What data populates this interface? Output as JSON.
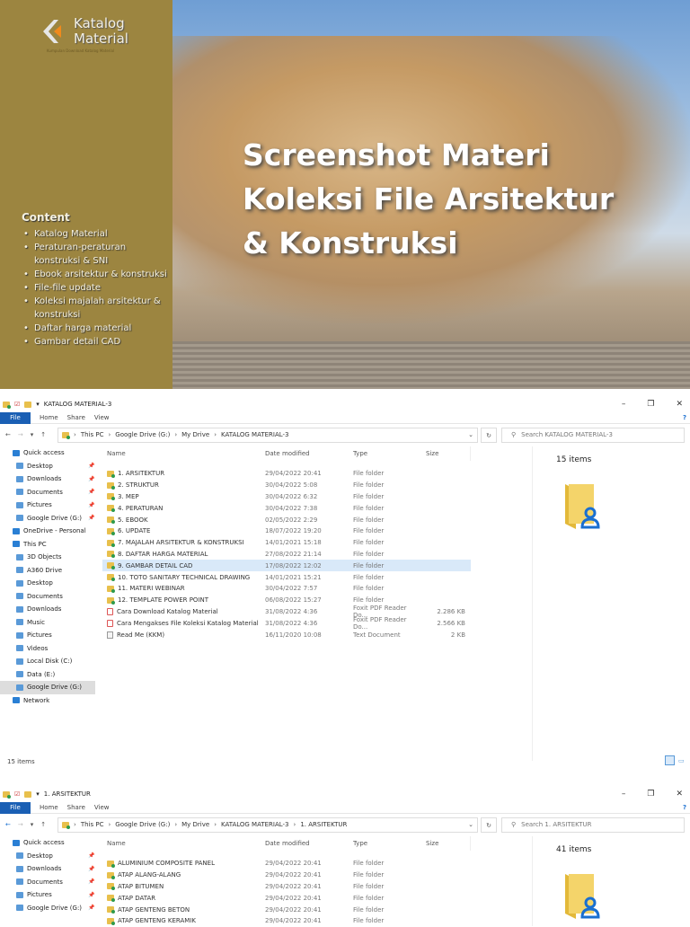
{
  "hero": {
    "logo_line1": "Katalog",
    "logo_line2": "Material",
    "logo_sub": "Kumpulan Download Katalog Material",
    "title_lines": [
      "Screenshot Materi",
      "Koleksi File Arsitektur",
      "& Konstruksi"
    ],
    "content_title": "Content",
    "content_items": [
      "Katalog Material",
      "Peraturan-peraturan konstruksi & SNI",
      "Ebook arsitektur & konstruksi",
      "File-file update",
      "Koleksi majalah arsitektur & konstruksi",
      "Daftar harga material",
      "Gambar detail CAD"
    ]
  },
  "win1": {
    "title": "KATALOG MATERIAL-3",
    "tabs": [
      "File",
      "Home",
      "Share",
      "View"
    ],
    "path": [
      "This PC",
      "Google Drive (G:)",
      "My Drive",
      "KATALOG MATERIAL-3"
    ],
    "search_placeholder": "Search KATALOG MATERIAL-3",
    "columns": [
      "Name",
      "Date modified",
      "Type",
      "Size"
    ],
    "nav": [
      {
        "label": "Quick access",
        "top": true
      },
      {
        "label": "Desktop",
        "pin": true
      },
      {
        "label": "Downloads",
        "pin": true
      },
      {
        "label": "Documents",
        "pin": true
      },
      {
        "label": "Pictures",
        "pin": true
      },
      {
        "label": "Google Drive (G:)",
        "pin": true
      },
      {
        "label": "OneDrive - Personal",
        "top": true
      },
      {
        "label": "This PC",
        "top": true
      },
      {
        "label": "3D Objects"
      },
      {
        "label": "A360 Drive"
      },
      {
        "label": "Desktop"
      },
      {
        "label": "Documents"
      },
      {
        "label": "Downloads"
      },
      {
        "label": "Music"
      },
      {
        "label": "Pictures"
      },
      {
        "label": "Videos"
      },
      {
        "label": "Local Disk (C:)"
      },
      {
        "label": "Data (E:)"
      },
      {
        "label": "Google Drive (G:)",
        "selected": true
      },
      {
        "label": "Network",
        "top": true
      }
    ],
    "files": [
      {
        "name": "1. ARSITEKTUR",
        "date": "29/04/2022 20:41",
        "type": "File folder",
        "size": "",
        "kind": "folder"
      },
      {
        "name": "2. STRUKTUR",
        "date": "30/04/2022 5:08",
        "type": "File folder",
        "size": "",
        "kind": "folder"
      },
      {
        "name": "3. MEP",
        "date": "30/04/2022 6:32",
        "type": "File folder",
        "size": "",
        "kind": "folder"
      },
      {
        "name": "4. PERATURAN",
        "date": "30/04/2022 7:38",
        "type": "File folder",
        "size": "",
        "kind": "folder"
      },
      {
        "name": "5. EBOOK",
        "date": "02/05/2022 2:29",
        "type": "File folder",
        "size": "",
        "kind": "folder"
      },
      {
        "name": "6. UPDATE",
        "date": "18/07/2022 19:20",
        "type": "File folder",
        "size": "",
        "kind": "folder"
      },
      {
        "name": "7. MAJALAH ARSITEKTUR & KONSTRUKSI",
        "date": "14/01/2021 15:18",
        "type": "File folder",
        "size": "",
        "kind": "folder"
      },
      {
        "name": "8. DAFTAR HARGA MATERIAL",
        "date": "27/08/2022 21:14",
        "type": "File folder",
        "size": "",
        "kind": "folder"
      },
      {
        "name": "9. GAMBAR DETAIL CAD",
        "date": "17/08/2022 12:02",
        "type": "File folder",
        "size": "",
        "kind": "folder",
        "selected": true
      },
      {
        "name": "10. TOTO SANITARY TECHNICAL DRAWING",
        "date": "14/01/2021 15:21",
        "type": "File folder",
        "size": "",
        "kind": "folder"
      },
      {
        "name": "11. MATERI WEBINAR",
        "date": "30/04/2022 7:57",
        "type": "File folder",
        "size": "",
        "kind": "folder"
      },
      {
        "name": "12. TEMPLATE POWER POINT",
        "date": "06/08/2022 15:27",
        "type": "File folder",
        "size": "",
        "kind": "folder"
      },
      {
        "name": "Cara Download Katalog Material",
        "date": "31/08/2022 4:36",
        "type": "Foxit PDF Reader Do...",
        "size": "2.286 KB",
        "kind": "pdf"
      },
      {
        "name": "Cara Mengakses File Koleksi Katalog Material",
        "date": "31/08/2022 4:36",
        "type": "Foxit PDF Reader Do...",
        "size": "2.566 KB",
        "kind": "pdf"
      },
      {
        "name": "Read Me (KKM)",
        "date": "16/11/2020 10:08",
        "type": "Text Document",
        "size": "2 KB",
        "kind": "txt"
      }
    ],
    "item_count": "15 items",
    "status": "15 items"
  },
  "win2": {
    "title": "1. ARSITEKTUR",
    "tabs": [
      "File",
      "Home",
      "Share",
      "View"
    ],
    "path": [
      "This PC",
      "Google Drive (G:)",
      "My Drive",
      "KATALOG MATERIAL-3",
      "1. ARSITEKTUR"
    ],
    "search_placeholder": "Search 1. ARSITEKTUR",
    "columns": [
      "Name",
      "Date modified",
      "Type",
      "Size"
    ],
    "nav": [
      {
        "label": "Quick access",
        "top": true
      },
      {
        "label": "Desktop",
        "pin": true
      },
      {
        "label": "Downloads",
        "pin": true
      },
      {
        "label": "Documents",
        "pin": true
      },
      {
        "label": "Pictures",
        "pin": true
      },
      {
        "label": "Google Drive (G:)",
        "pin": true
      }
    ],
    "files": [
      {
        "name": "ALUMINIUM COMPOSITE PANEL",
        "date": "29/04/2022 20:41",
        "type": "File folder",
        "size": "",
        "kind": "folder"
      },
      {
        "name": "ATAP ALANG-ALANG",
        "date": "29/04/2022 20:41",
        "type": "File folder",
        "size": "",
        "kind": "folder"
      },
      {
        "name": "ATAP BITUMEN",
        "date": "29/04/2022 20:41",
        "type": "File folder",
        "size": "",
        "kind": "folder"
      },
      {
        "name": "ATAP DATAR",
        "date": "29/04/2022 20:41",
        "type": "File folder",
        "size": "",
        "kind": "folder"
      },
      {
        "name": "ATAP GENTENG BETON",
        "date": "29/04/2022 20:41",
        "type": "File folder",
        "size": "",
        "kind": "folder"
      },
      {
        "name": "ATAP GENTENG KERAMIK",
        "date": "29/04/2022 20:41",
        "type": "File folder",
        "size": "",
        "kind": "folder"
      }
    ],
    "item_count": "41 items"
  }
}
